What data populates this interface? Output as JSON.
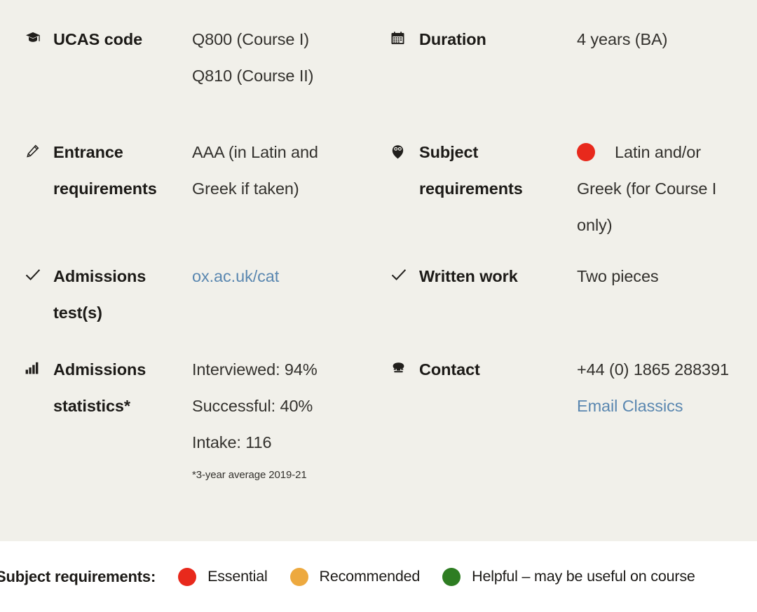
{
  "panel": {
    "rows": [
      {
        "left": {
          "icon": "graduation-cap-icon",
          "label": "UCAS code",
          "lines": [
            "Q800 (Course I)",
            "Q810 (Course II)"
          ]
        },
        "right": {
          "icon": "calendar-icon",
          "label": "Duration",
          "lines": [
            "4 years (BA)"
          ]
        }
      },
      {
        "left": {
          "icon": "pencil-icon",
          "label": "Entrance requirements",
          "lines": [
            "AAA (in Latin and",
            "Greek if taken)"
          ]
        },
        "right": {
          "icon": "owl-icon",
          "label": "Subject requirements",
          "dot_color": "#e8291c",
          "lines": [
            "Latin and/or",
            "Greek (for Course I",
            "only)"
          ]
        }
      },
      {
        "left": {
          "icon": "check-icon",
          "label": "Admissions test(s)",
          "link_text": "ox.ac.uk/cat"
        },
        "right": {
          "icon": "check-icon",
          "label": "Written work",
          "lines": [
            "Two pieces"
          ]
        }
      },
      {
        "left": {
          "icon": "bar-chart-icon",
          "label": "Admissions statistics*",
          "lines": [
            "Interviewed: 94%",
            "Successful: 40%",
            "Intake: 116"
          ],
          "footnote": "*3-year average 2019-21"
        },
        "right": {
          "icon": "telephone-icon",
          "label": "Contact",
          "lines": [
            "+44 (0) 1865 288391"
          ],
          "link_text": "Email Classics"
        }
      }
    ]
  },
  "legend": {
    "title": "Subject requirements:",
    "items": [
      {
        "color": "#e8291c",
        "label": "Essential"
      },
      {
        "color": "#eda93f",
        "label": "Recommended"
      },
      {
        "color": "#2e7d22",
        "label": "Helpful – may be useful on course"
      }
    ]
  },
  "stats": {
    "interviewed_pct": 94,
    "successful_pct": 40,
    "intake": 116
  }
}
